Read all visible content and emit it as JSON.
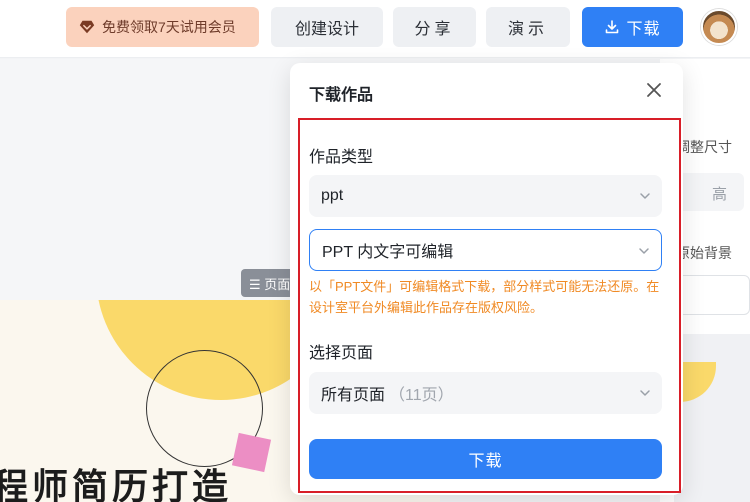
{
  "topbar": {
    "vip_label": "免费领取7天试用会员",
    "create_label": "创建设计",
    "share_label": "分享",
    "present_label": "演示",
    "download_label": "下载",
    "accent_color": "#2f80f5",
    "vip_bg_color": "#fbd2bd"
  },
  "canvas": {
    "slide_title": "程师简历打造",
    "page_tag": "☰ 页面"
  },
  "right_panel": {
    "resize_label": "调整尺寸",
    "height_label": "高",
    "bg_label": "原始背景"
  },
  "modal": {
    "title": "下载作品",
    "type_label": "作品类型",
    "file_format": "ppt",
    "edit_mode": "PPT 内文字可编辑",
    "warning": "以「PPT文件」可编辑格式下载，部分样式可能无法还原。在设计室平台外编辑此作品存在版权风险。",
    "pages_label": "选择页面",
    "pages_value": "所有页面",
    "pages_count": "（11页）",
    "download_button": "下载",
    "warning_color": "#f08a24",
    "highlight_frame_color": "#d81e28"
  }
}
